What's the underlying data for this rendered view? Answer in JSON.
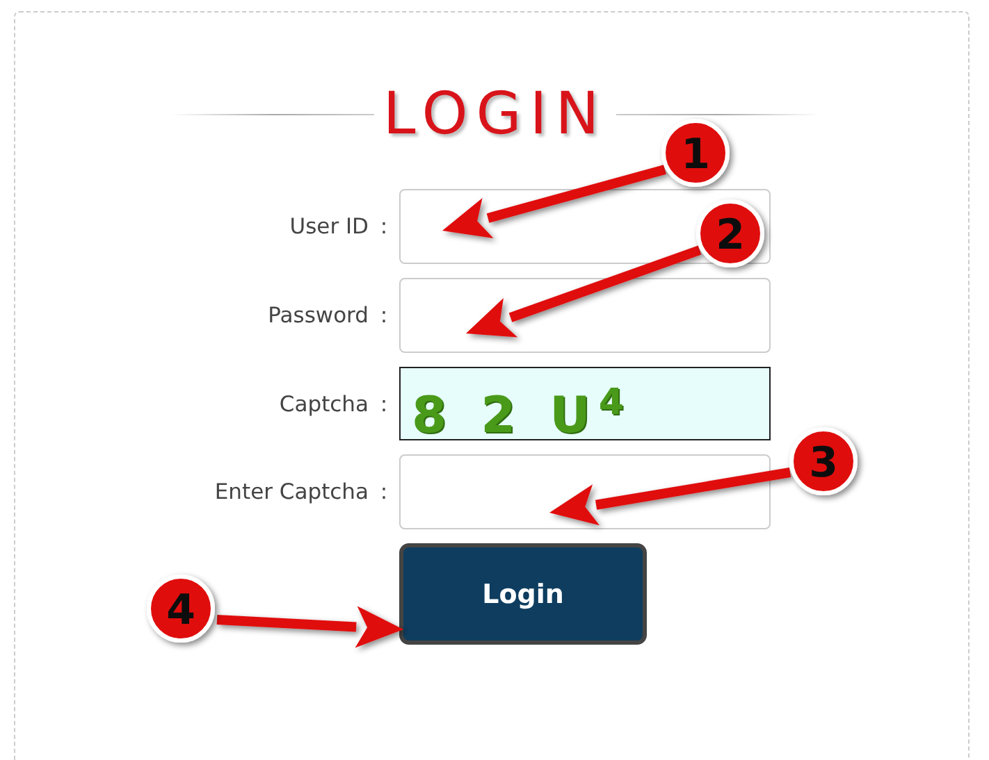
{
  "title": "LOGIN",
  "fields": [
    {
      "label": "User ID",
      "separator": ":",
      "kind": "input"
    },
    {
      "label": "Password",
      "separator": ":",
      "kind": "password"
    },
    {
      "label": "Captcha",
      "separator": ":",
      "kind": "captcha",
      "captcha_text": "8 2 U$^{4}$"
    },
    {
      "label": "Enter Captcha",
      "separator": ":",
      "kind": "input"
    }
  ],
  "button": "Login",
  "annotations": [
    {
      "number": "1"
    },
    {
      "number": "2"
    },
    {
      "number": "3"
    },
    {
      "number": "4"
    }
  ]
}
